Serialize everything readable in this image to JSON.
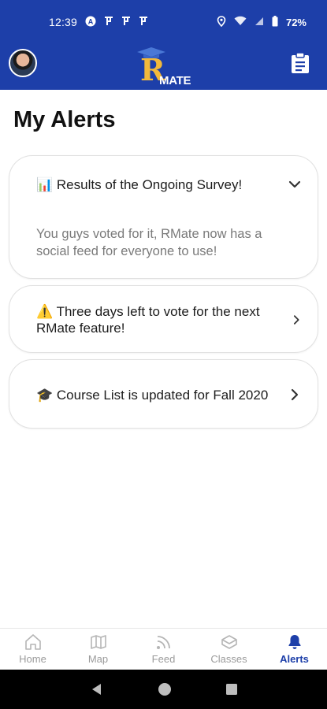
{
  "status_bar": {
    "time": "12:39",
    "left_icons": [
      "a-icon",
      "r-icon",
      "r-icon",
      "r-icon"
    ],
    "battery": "72%"
  },
  "header": {
    "logo_letter": "R",
    "logo_text": "MATE"
  },
  "page": {
    "title": "My Alerts"
  },
  "alerts": [
    {
      "emoji": "📊",
      "title": "Results of the Ongoing Survey!",
      "expanded": true,
      "body": "You guys voted for it, RMate now has a  social feed for everyone to use!"
    },
    {
      "emoji": "⚠️",
      "title": "Three days left to vote for the next RMate feature!",
      "expanded": false
    },
    {
      "emoji": "🎓",
      "title": "Course List is updated for Fall 2020",
      "expanded": false
    }
  ],
  "bottom_nav": [
    {
      "label": "Home",
      "icon": "home-icon",
      "active": false
    },
    {
      "label": "Map",
      "icon": "map-icon",
      "active": false
    },
    {
      "label": "Feed",
      "icon": "feed-icon",
      "active": false
    },
    {
      "label": "Classes",
      "icon": "classes-icon",
      "active": false
    },
    {
      "label": "Alerts",
      "icon": "bell-icon",
      "active": true
    }
  ],
  "colors": {
    "brand_blue": "#1d3fa9",
    "logo_gold": "#f2b93b",
    "inactive_gray": "#9b9b9b"
  }
}
